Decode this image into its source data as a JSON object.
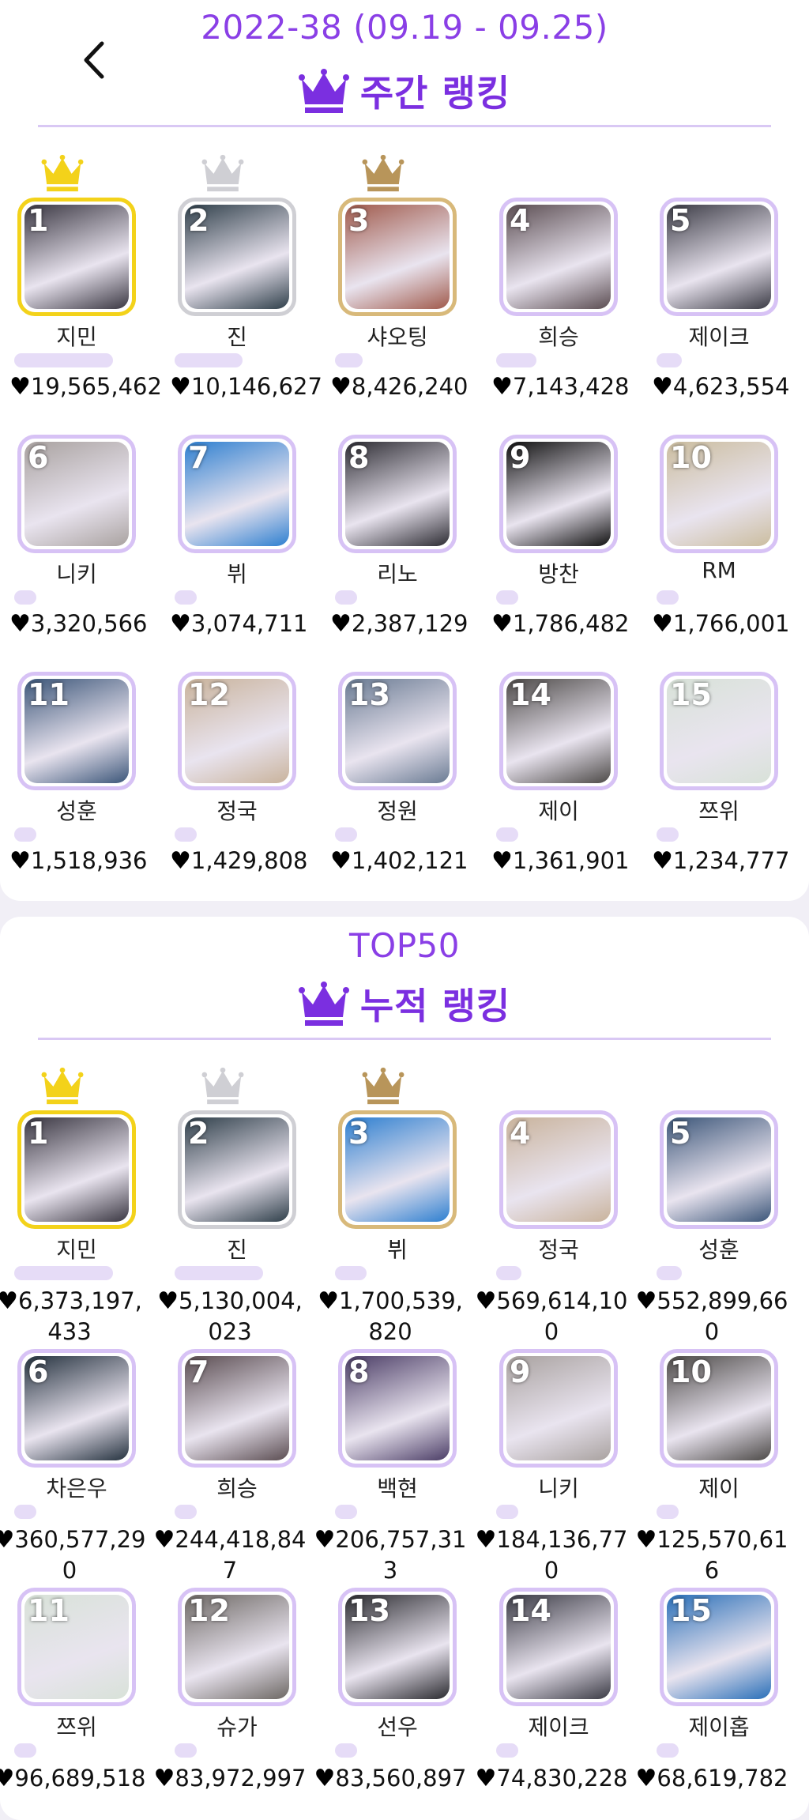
{
  "weekly": {
    "period": "2022-38 (09.19 - 09.25)",
    "title": "주간 랭킹",
    "entries": [
      {
        "rank": "1",
        "name": "지민",
        "votes": "19,565,462",
        "bar": 0.78,
        "bg": "#3a3742",
        "medal": "gold"
      },
      {
        "rank": "2",
        "name": "진",
        "votes": "10,146,627",
        "bar": 0.54,
        "bg": "#2f3f4a",
        "medal": "silver"
      },
      {
        "rank": "3",
        "name": "샤오팅",
        "votes": "8,426,240",
        "bar": 0.22,
        "bg": "#a05a4c",
        "medal": "bronze"
      },
      {
        "rank": "4",
        "name": "희승",
        "votes": "7,143,428",
        "bar": 0.32,
        "bg": "#5b4d52"
      },
      {
        "rank": "5",
        "name": "제이크",
        "votes": "4,623,554",
        "bar": 0.2,
        "bg": "#3b3b45"
      },
      {
        "rank": "6",
        "name": "니키",
        "votes": "3,320,566",
        "bar": 0.17,
        "bg": "#a9a2a0"
      },
      {
        "rank": "7",
        "name": "뷔",
        "votes": "3,074,711",
        "bar": 0.16,
        "bg": "#2e7fd0"
      },
      {
        "rank": "8",
        "name": "리노",
        "votes": "2,387,129",
        "bar": 0.12,
        "bg": "#2d2c33"
      },
      {
        "rank": "9",
        "name": "방찬",
        "votes": "1,786,482",
        "bar": 0.12,
        "bg": "#111111"
      },
      {
        "rank": "10",
        "name": "RM",
        "votes": "1,766,001",
        "bar": 0.12,
        "bg": "#cbbd9f"
      },
      {
        "rank": "11",
        "name": "성훈",
        "votes": "1,518,936",
        "bar": 0.1,
        "bg": "#3c5679"
      },
      {
        "rank": "12",
        "name": "정국",
        "votes": "1,429,808",
        "bar": 0.1,
        "bg": "#c9b39c"
      },
      {
        "rank": "13",
        "name": "정원",
        "votes": "1,402,121",
        "bar": 0.1,
        "bg": "#6a7b93"
      },
      {
        "rank": "14",
        "name": "제이",
        "votes": "1,361,901",
        "bar": 0.1,
        "bg": "#4d4a48"
      },
      {
        "rank": "15",
        "name": "쯔위",
        "votes": "1,234,777",
        "bar": 0.1,
        "bg": "#d8e2d8"
      }
    ]
  },
  "total": {
    "label": "TOP50",
    "title": "누적 랭킹",
    "entries": [
      {
        "rank": "1",
        "name": "지민",
        "votes": "6,373,197,433",
        "bar": 0.78,
        "bg": "#3a3742",
        "medal": "gold"
      },
      {
        "rank": "2",
        "name": "진",
        "votes": "5,130,004,023",
        "bar": 0.7,
        "bg": "#2f3f4a",
        "medal": "silver"
      },
      {
        "rank": "3",
        "name": "뷔",
        "votes": "1,700,539,820",
        "bar": 0.25,
        "bg": "#2e7fd0",
        "medal": "bronze"
      },
      {
        "rank": "4",
        "name": "정국",
        "votes": "569,614,100",
        "bar": 0.2,
        "bg": "#c9b39c"
      },
      {
        "rank": "5",
        "name": "성훈",
        "votes": "552,899,660",
        "bar": 0.2,
        "bg": "#3c5679"
      },
      {
        "rank": "6",
        "name": "차은우",
        "votes": "360,577,290",
        "bar": 0.17,
        "bg": "#25323f"
      },
      {
        "rank": "7",
        "name": "희승",
        "votes": "244,418,847",
        "bar": 0.15,
        "bg": "#5b4d52"
      },
      {
        "rank": "8",
        "name": "백현",
        "votes": "206,757,313",
        "bar": 0.15,
        "bg": "#4b3d66"
      },
      {
        "rank": "9",
        "name": "니키",
        "votes": "184,136,770",
        "bar": 0.15,
        "bg": "#a9a2a0"
      },
      {
        "rank": "10",
        "name": "제이",
        "votes": "125,570,616",
        "bar": 0.15,
        "bg": "#4d4a48"
      },
      {
        "rank": "11",
        "name": "쯔위",
        "votes": "96,689,518",
        "bar": 0.15,
        "bg": "#d8e2d8"
      },
      {
        "rank": "12",
        "name": "슈가",
        "votes": "83,972,997",
        "bar": 0.15,
        "bg": "#6d6864"
      },
      {
        "rank": "13",
        "name": "선우",
        "votes": "83,560,897",
        "bar": 0.15,
        "bg": "#2b2b30"
      },
      {
        "rank": "14",
        "name": "제이크",
        "votes": "74,830,228",
        "bar": 0.15,
        "bg": "#3b3b45"
      },
      {
        "rank": "15",
        "name": "제이홉",
        "votes": "68,619,782",
        "bar": 0.15,
        "bg": "#2a6fb8"
      }
    ]
  },
  "colors": {
    "accent": "#7b2fe0",
    "gold": "#f3d21a",
    "silver": "#cfcfd4",
    "bronze": "#b8955a",
    "frame": "#d7c2f5",
    "bar": "#e6dcf7"
  },
  "icons": {
    "back": "chevron-left-icon",
    "crown": "crown-icon",
    "heart": "heart-icon"
  }
}
